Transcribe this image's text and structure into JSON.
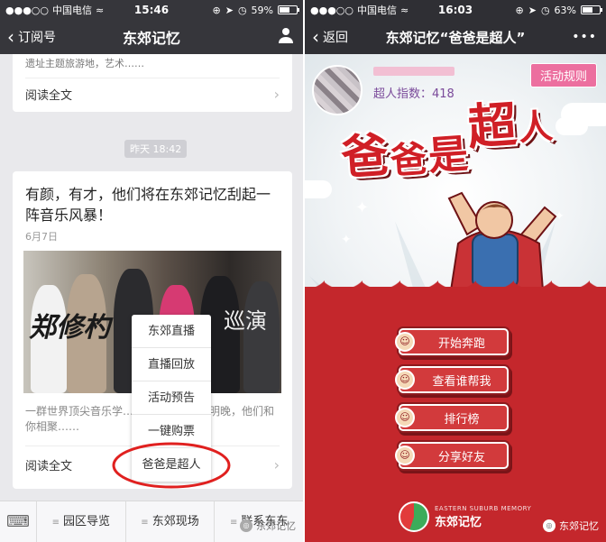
{
  "left": {
    "status": {
      "carrier": "中国电信",
      "time": "15:46",
      "battery": "59%",
      "battery_level": 0.59
    },
    "nav": {
      "back_label": "订阅号",
      "title": "东郊记忆"
    },
    "prev_card": {
      "snippet": "遗址主题旅游地，艺术……",
      "read_all": "阅读全文"
    },
    "timestamp": "昨天 18:42",
    "article": {
      "title": "有颜，有才，他们将在东郊记忆刮起一阵音乐风暴！",
      "date": "6月7日",
      "photo_text_left": "郑修杓",
      "photo_text_right": "巡演",
      "excerpt": "一群世界顶尖音乐学……院的音乐人，明晚，他们和你相聚……",
      "read_all": "阅读全文"
    },
    "menu": {
      "items": [
        "东郊直播",
        "直播回放",
        "活动预告",
        "一键购票",
        "爸爸是超人"
      ]
    },
    "tabbar": {
      "tabs": [
        "园区导览",
        "东郊现场",
        "联系东东"
      ]
    },
    "watermark": "东郊记忆"
  },
  "right": {
    "status": {
      "carrier": "中国电信",
      "time": "16:03",
      "battery": "63%",
      "battery_level": 0.63
    },
    "nav": {
      "back_label": "返回",
      "title": "东郊记忆“爸爸是超人”",
      "more": "•••"
    },
    "user": {
      "index_label": "超人指数：418"
    },
    "rules_button": "活动规则",
    "hero_title": [
      "爸",
      "爸",
      "是",
      "超",
      "人"
    ],
    "buttons": [
      "开始奔跑",
      "查看谁帮我",
      "排行榜",
      "分享好友"
    ],
    "logo": {
      "en": "EASTERN SUBURB MEMORY",
      "cn": "东郊记忆"
    },
    "watermark": "东郊记忆"
  },
  "colors": {
    "accent_red": "#b91f24",
    "pink": "#ec6f9f",
    "nav_dark": "#36363b"
  }
}
